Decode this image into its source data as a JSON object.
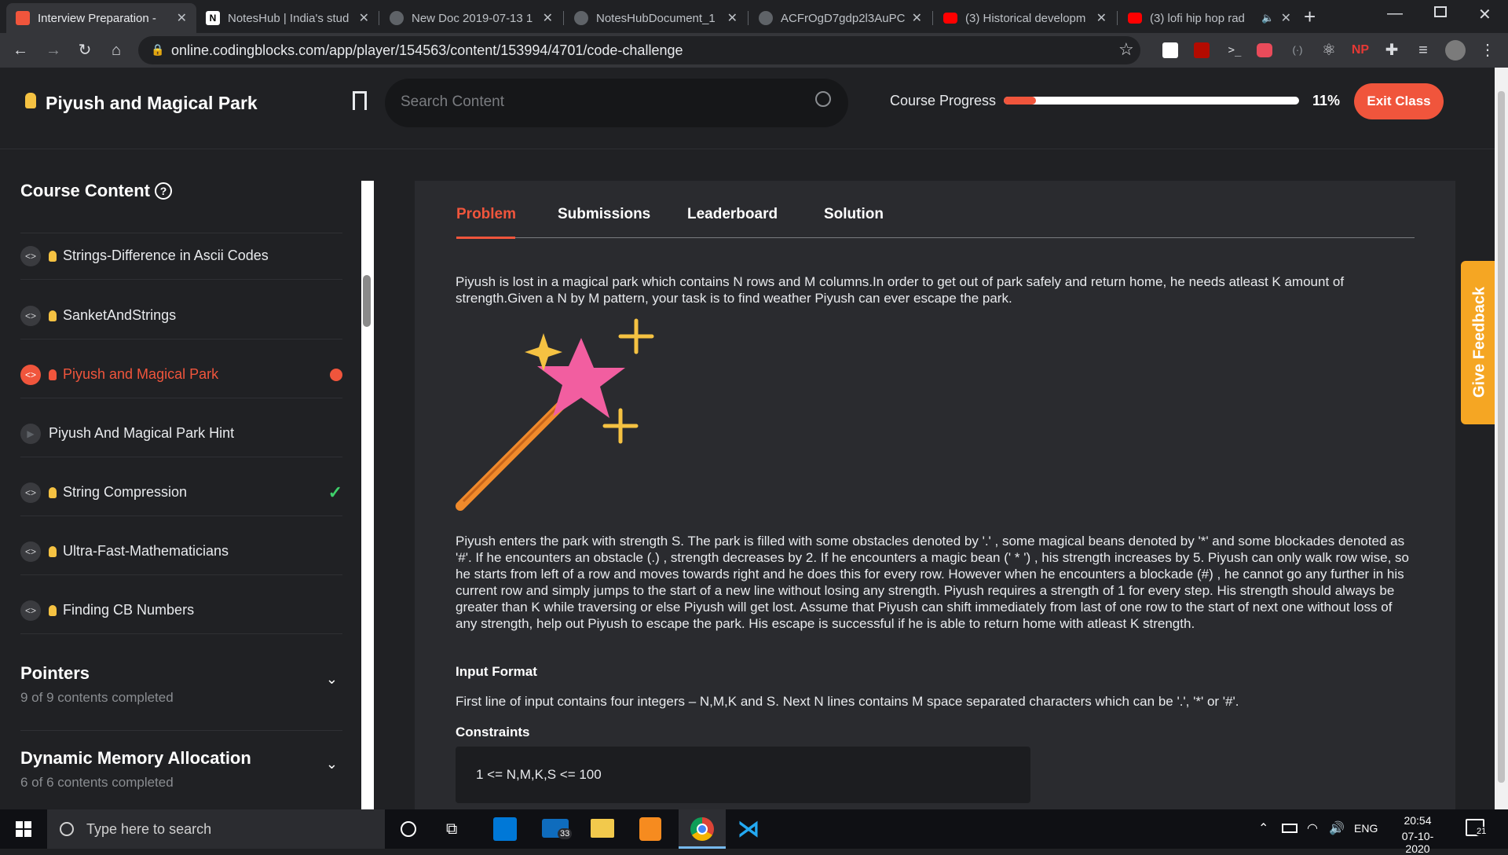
{
  "browser": {
    "tabs": [
      {
        "title": "Interview Preparation -",
        "favicon": "codingblocks-icon",
        "color": "#f0553c"
      },
      {
        "title": "NotesHub | India's stud",
        "favicon": "noteshub-icon",
        "color": "#ffffff"
      },
      {
        "title": "New Doc 2019-07-13 1",
        "favicon": "globe-icon",
        "color": "#9aa0a6"
      },
      {
        "title": "NotesHubDocument_1",
        "favicon": "globe-icon",
        "color": "#9aa0a6"
      },
      {
        "title": "ACFrOgD7gdp2l3AuPC",
        "favicon": "globe-icon",
        "color": "#9aa0a6"
      },
      {
        "title": "(3) Historical developm",
        "favicon": "youtube-icon",
        "color": "#ff0000"
      },
      {
        "title": "(3) lofi hip hop rad",
        "favicon": "youtube-icon",
        "color": "#ff0000"
      }
    ],
    "url": "online.codingblocks.com/app/player/154563/content/153994/4701/code-challenge"
  },
  "header": {
    "title": "Piyush and Magical Park",
    "search_placeholder": "Search Content",
    "progress_label": "Course Progress",
    "progress_value": 0.11,
    "progress_text": "11%",
    "exit_label": "Exit Class"
  },
  "sidebar": {
    "heading": "Course Content",
    "items": [
      {
        "label": "Strings-Difference in Ascii Codes",
        "state": "normal"
      },
      {
        "label": "SanketAndStrings",
        "state": "normal"
      },
      {
        "label": "Piyush and Magical Park",
        "state": "active"
      },
      {
        "label": "Piyush And Magical Park Hint",
        "state": "video"
      },
      {
        "label": "String Compression",
        "state": "done"
      },
      {
        "label": "Ultra-Fast-Mathematicians",
        "state": "normal"
      },
      {
        "label": "Finding CB Numbers",
        "state": "normal"
      }
    ],
    "sections": [
      {
        "title": "Pointers",
        "subtitle": "9 of 9 contents completed"
      },
      {
        "title": "Dynamic Memory Allocation",
        "subtitle": "6 of 6 contents completed"
      }
    ]
  },
  "problem": {
    "tabs": [
      "Problem",
      "Submissions",
      "Leaderboard",
      "Solution"
    ],
    "intro": "Piyush is lost in a magical park which contains N rows and M columns.In order to get out of park safely and return home, he needs atleast K amount of strength.Given a N by M pattern, your task is to find weather Piyush can ever escape the park.",
    "body": "Piyush enters the park with strength S. The park is filled with some obstacles denoted by '.' , some magical beans denoted by '*' and some blockades denoted as '#'. If he encounters an obstacle (.) , strength decreases by 2. If he encounters a magic bean (' * ') , his strength increases by 5. Piyush can only walk row wise, so he starts from left of a row and moves towards right and he does this for every row. However when he encounters a blockade (#) , he cannot go any further in his current row and simply jumps to the start of a new line without losing any strength. Piyush requires a strength of 1 for every step. His strength should always be greater than K while traversing or else Piyush will get lost. Assume that Piyush can shift immediately from last of one row to the start of next one without loss of any strength, help out Piyush to escape the park. His escape is successful if he is able to return home with atleast K strength.",
    "input_heading": "Input Format",
    "input_text": "First line of input contains four integers – N,M,K and S. Next N lines contains M space separated characters which can be '.', '*' or '#'.",
    "constraints_heading": "Constraints",
    "constraints_text": "1 <= N,M,K,S <= 100"
  },
  "feedback_label": "Give Feedback",
  "taskbar": {
    "search_placeholder": "Type here to search",
    "mail_badge": "33",
    "lang": "ENG",
    "time": "20:54",
    "date": "07-10-2020",
    "notif_count": "21"
  },
  "colors": {
    "accent": "#f0553c",
    "done": "#3ecf6a",
    "bulb": "#f5c242"
  }
}
